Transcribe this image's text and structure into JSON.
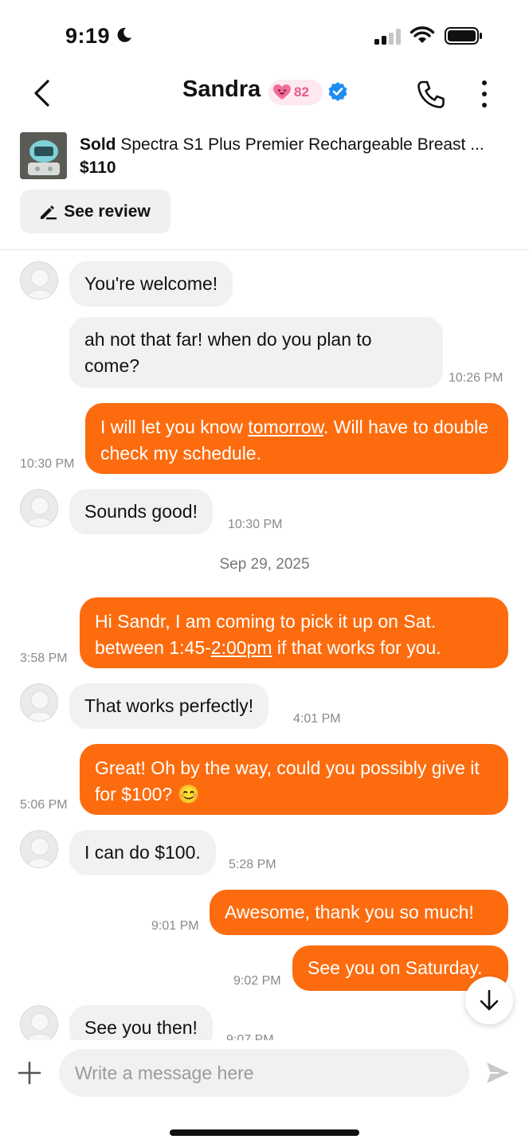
{
  "status_bar": {
    "time": "9:19"
  },
  "header": {
    "name": "Sandra",
    "score": "82"
  },
  "listing": {
    "status": "Sold",
    "title": "Spectra S1 Plus Premier Rechargeable Breast ...",
    "price": "$110",
    "review_button": "See review"
  },
  "messages": [
    {
      "from": "them",
      "text": "You're welcome!",
      "time": ""
    },
    {
      "from": "them",
      "text": "ah not that far! when do you plan to come?",
      "time": "10:26 PM"
    },
    {
      "from": "me",
      "text_before": "I will let you know ",
      "link": "tomorrow",
      "text_after": ". Will have to double check my schedule.",
      "time": "10:30 PM"
    },
    {
      "from": "them",
      "text": "Sounds good!",
      "time": "10:30 PM"
    },
    {
      "from": "me",
      "text_before": "Hi Sandr, I am coming to pick it up on Sat. between 1:45-",
      "link": "2:00pm",
      "text_after": " if that works for you.",
      "time": "3:58 PM"
    },
    {
      "from": "them",
      "text": "That works perfectly!",
      "time": "4:01 PM"
    },
    {
      "from": "me",
      "text": "Great! Oh by the way, could you possibly give it for $100? 😊",
      "time": "5:06 PM"
    },
    {
      "from": "them",
      "text": "I can do $100.",
      "time": "5:28 PM"
    },
    {
      "from": "me",
      "text": "Awesome, thank you so much!",
      "time": "9:01 PM"
    },
    {
      "from": "me",
      "text": "See you on Saturday.",
      "time": "9:02 PM"
    },
    {
      "from": "them",
      "text": "See you then!",
      "time": "9:07 PM"
    }
  ],
  "date_separator": "Sep 29, 2025",
  "composer": {
    "placeholder": "Write a message here"
  },
  "colors": {
    "accent": "#fc6c0f",
    "incoming_bubble": "#f1f1f3",
    "verified": "#1f8ef1"
  }
}
